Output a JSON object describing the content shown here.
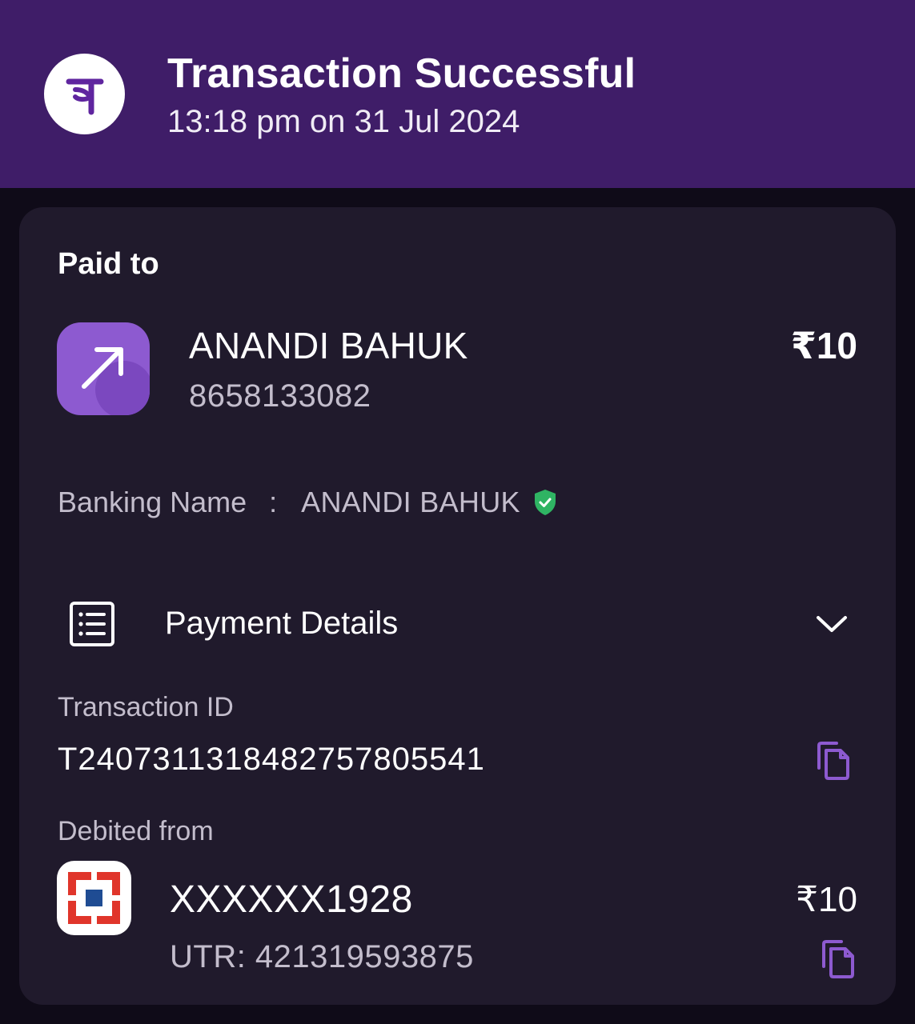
{
  "header": {
    "title": "Transaction Successful",
    "datetime": "13:18 pm on 31 Jul 2024",
    "logo_icon": "phonepe-logo-icon",
    "background": "#3f1d68"
  },
  "payee": {
    "section_label": "Paid to",
    "name": "ANANDI BAHUK",
    "phone": "8658133082",
    "amount": "₹10",
    "icon": "arrow-up-right-icon"
  },
  "banking": {
    "label": "Banking Name",
    "separator": ":",
    "value": "ANANDI BAHUK",
    "verified_icon": "verified-shield-icon",
    "verified_color": "#2fb463"
  },
  "payment_details": {
    "label": "Payment Details",
    "icon": "receipt-list-icon",
    "toggle_icon": "chevron-down-icon"
  },
  "transaction": {
    "id_label": "Transaction ID",
    "id": "T2407311318482757805541",
    "copy_icon": "copy-icon"
  },
  "debit": {
    "label": "Debited from",
    "account": "XXXXXX1928",
    "amount": "₹10",
    "utr": "UTR: 421319593875",
    "bank_icon": "hdfc-bank-logo-icon",
    "copy_icon": "copy-icon"
  },
  "colors": {
    "accent": "#8d5ad0",
    "card": "#201a2c",
    "muted_text": "#c3bdcc"
  }
}
